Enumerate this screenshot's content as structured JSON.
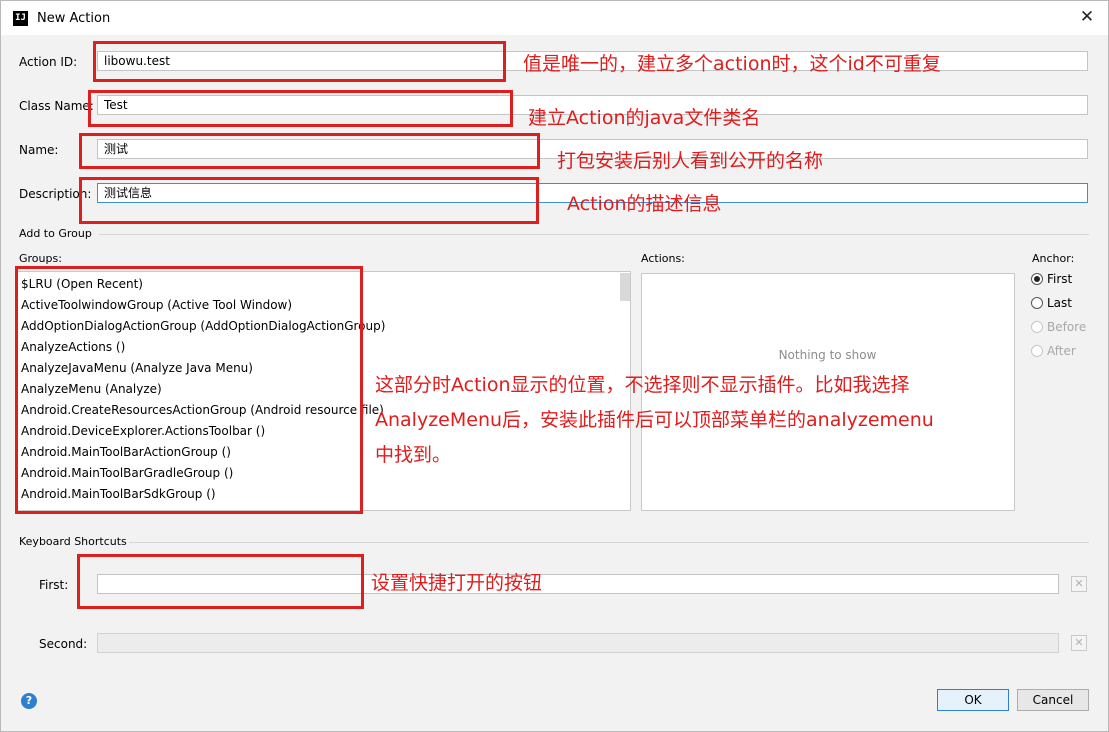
{
  "window": {
    "icon_text": "IJ",
    "title": "New Action",
    "close_glyph": "✕"
  },
  "form": {
    "action_id_label": "Action ID:",
    "action_id_value": "libowu.test",
    "class_name_label": "Class Name:",
    "class_name_value": "Test",
    "name_label": "Name:",
    "name_value": "测试",
    "description_label": "Description:",
    "description_value": "测试信息"
  },
  "add_to_group": {
    "section_label": "Add to Group",
    "groups_label": "Groups:",
    "groups": [
      "$LRU (Open Recent)",
      "ActiveToolwindowGroup (Active Tool Window)",
      "AddOptionDialogActionGroup (AddOptionDialogActionGroup)",
      "AnalyzeActions ()",
      "AnalyzeJavaMenu (Analyze Java Menu)",
      "AnalyzeMenu (Analyze)",
      "Android.CreateResourcesActionGroup (Android resource file)",
      "Android.DeviceExplorer.ActionsToolbar ()",
      "Android.MainToolBarActionGroup ()",
      "Android.MainToolBarGradleGroup ()",
      "Android.MainToolBarSdkGroup ()"
    ],
    "actions_label": "Actions:",
    "actions_empty": "Nothing to show",
    "anchor_label": "Anchor:",
    "anchor_options": [
      "First",
      "Last",
      "Before",
      "After"
    ],
    "anchor_selected": "First"
  },
  "keyboard_shortcuts": {
    "section_label": "Keyboard Shortcuts",
    "first_label": "First:",
    "first_value": "",
    "second_label": "Second:",
    "second_value": "",
    "clear_glyph": "✕"
  },
  "footer": {
    "help_glyph": "?",
    "ok_label": "OK",
    "cancel_label": "Cancel"
  },
  "annotations": {
    "action_id": "值是唯一的，建立多个action时，这个id不可重复",
    "class_name": "建立Action的java文件类名",
    "name": "打包安装后别人看到公开的名称",
    "description": "Action的描述信息",
    "groups_line1": "这部分时Action显示的位置，不选择则不显示插件。比如我选择",
    "groups_line2": "AnalyzeMenu后，安装此插件后可以顶部菜单栏的analyzemenu",
    "groups_line3": "中找到。",
    "shortcut": "设置快捷打开的按钮"
  },
  "colors": {
    "annotation_red": "#dd1f1f",
    "accent_blue": "#2f7fd1"
  }
}
